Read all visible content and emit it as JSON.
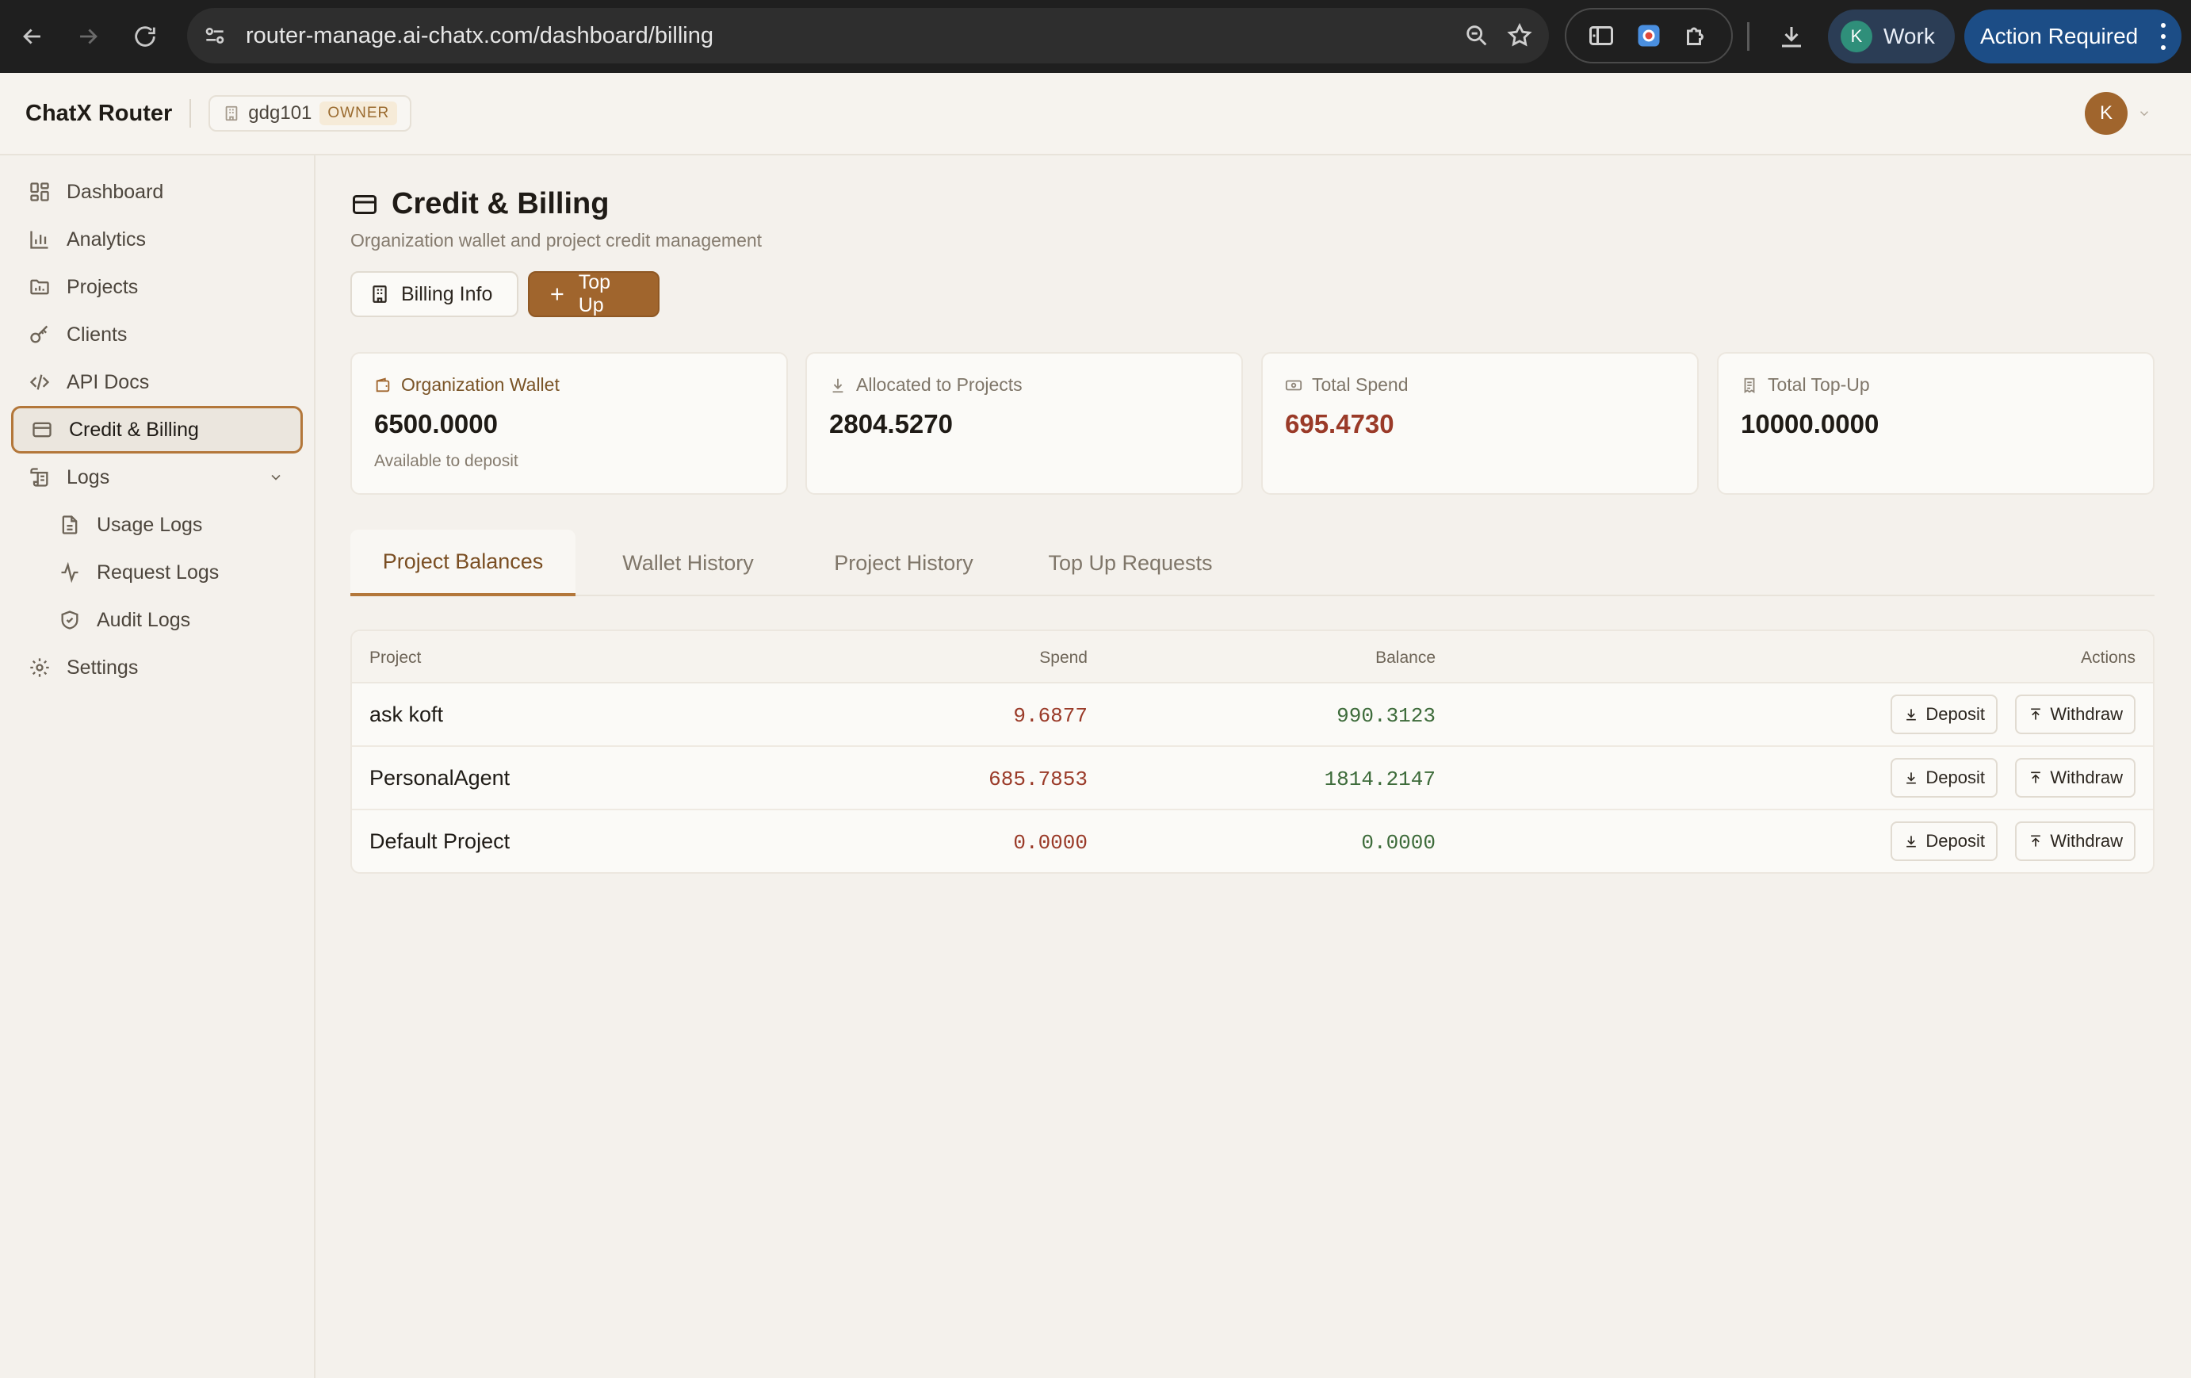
{
  "browser": {
    "url": "router-manage.ai-chatx.com/dashboard/billing",
    "profile_initial": "K",
    "profile_name": "Work",
    "action_label": "Action Required"
  },
  "header": {
    "brand": "ChatX Router",
    "org_name": "gdg101",
    "org_role": "OWNER",
    "user_initial": "K"
  },
  "sidebar": {
    "items": [
      {
        "label": "Dashboard",
        "icon": "grid-icon"
      },
      {
        "label": "Analytics",
        "icon": "bar-chart-icon"
      },
      {
        "label": "Projects",
        "icon": "folder-chart-icon"
      },
      {
        "label": "Clients",
        "icon": "key-icon"
      },
      {
        "label": "API Docs",
        "icon": "code-icon"
      },
      {
        "label": "Credit & Billing",
        "icon": "credit-card-icon",
        "active": true
      },
      {
        "label": "Logs",
        "icon": "scroll-icon"
      },
      {
        "label": "Usage Logs",
        "icon": "file-text-icon"
      },
      {
        "label": "Request Logs",
        "icon": "activity-icon"
      },
      {
        "label": "Audit Logs",
        "icon": "shield-check-icon"
      },
      {
        "label": "Settings",
        "icon": "gear-icon"
      }
    ]
  },
  "main": {
    "title": "Credit & Billing",
    "subtitle": "Organization wallet and project credit management",
    "billing_info_label": "Billing Info",
    "top_up_label": "Top Up",
    "cards": [
      {
        "label": "Organization Wallet",
        "value": "6500.0000",
        "note": "Available to deposit"
      },
      {
        "label": "Allocated to Projects",
        "value": "2804.5270"
      },
      {
        "label": "Total Spend",
        "value": "695.4730"
      },
      {
        "label": "Total Top-Up",
        "value": "10000.0000"
      }
    ],
    "tabs": [
      "Project Balances",
      "Wallet History",
      "Project History",
      "Top Up Requests"
    ],
    "active_tab": "Project Balances",
    "table": {
      "headers": {
        "project": "Project",
        "spend": "Spend",
        "balance": "Balance",
        "actions": "Actions"
      },
      "rows": [
        {
          "project": "ask koft",
          "spend": "9.6877",
          "balance": "990.3123"
        },
        {
          "project": "PersonalAgent",
          "spend": "685.7853",
          "balance": "1814.2147"
        },
        {
          "project": "Default Project",
          "spend": "0.0000",
          "balance": "0.0000"
        }
      ],
      "deposit_label": "Deposit",
      "withdraw_label": "Withdraw"
    }
  },
  "colors": {
    "accent": "#a0652d",
    "spend_red": "#9a3a28",
    "balance_green": "#3d6b3a"
  }
}
